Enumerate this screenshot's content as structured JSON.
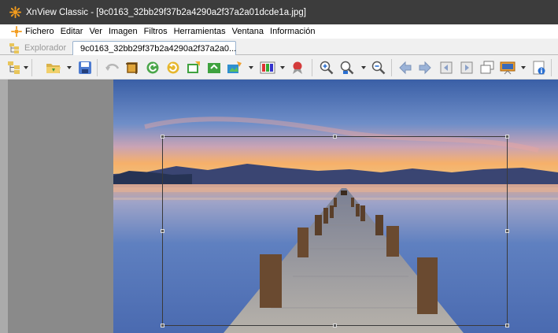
{
  "window": {
    "title": "XnView Classic - [9c0163_32bb29f37b2a4290a2f37a2a01dcde1a.jpg]"
  },
  "menu": {
    "items": [
      "Fichero",
      "Editar",
      "Ver",
      "Imagen",
      "Filtros",
      "Herramientas",
      "Ventana",
      "Información"
    ]
  },
  "tabs": {
    "explorer_label": "Explorador",
    "image_label": "9c0163_32bb29f37b2a4290a2f37a2a0..."
  },
  "toolbar": {
    "icons": [
      "browser-icon",
      "open-folder-icon",
      "save-icon",
      "undo-icon",
      "crop-icon",
      "rotate-left-icon",
      "rotate-right-icon",
      "import-icon",
      "export-icon",
      "adjust-icon",
      "color-icon",
      "effects-icon",
      "zoom-in-icon",
      "zoom-icon",
      "zoom-out-icon",
      "previous-icon",
      "next-icon",
      "first-page-icon",
      "last-page-icon",
      "window-icon",
      "slideshow-icon",
      "info-icon"
    ]
  },
  "colors": {
    "titlebar": "#3c3c3c",
    "viewer_bg": "#ababab",
    "left_pane": "#8a8a8a",
    "sky_top": "#3a5fa6",
    "horizon_glow": "#f6b06a",
    "water": "#4a6ab0"
  },
  "viewer": {
    "image_subject": "wooden pier extending into a calm lake at sunset"
  }
}
